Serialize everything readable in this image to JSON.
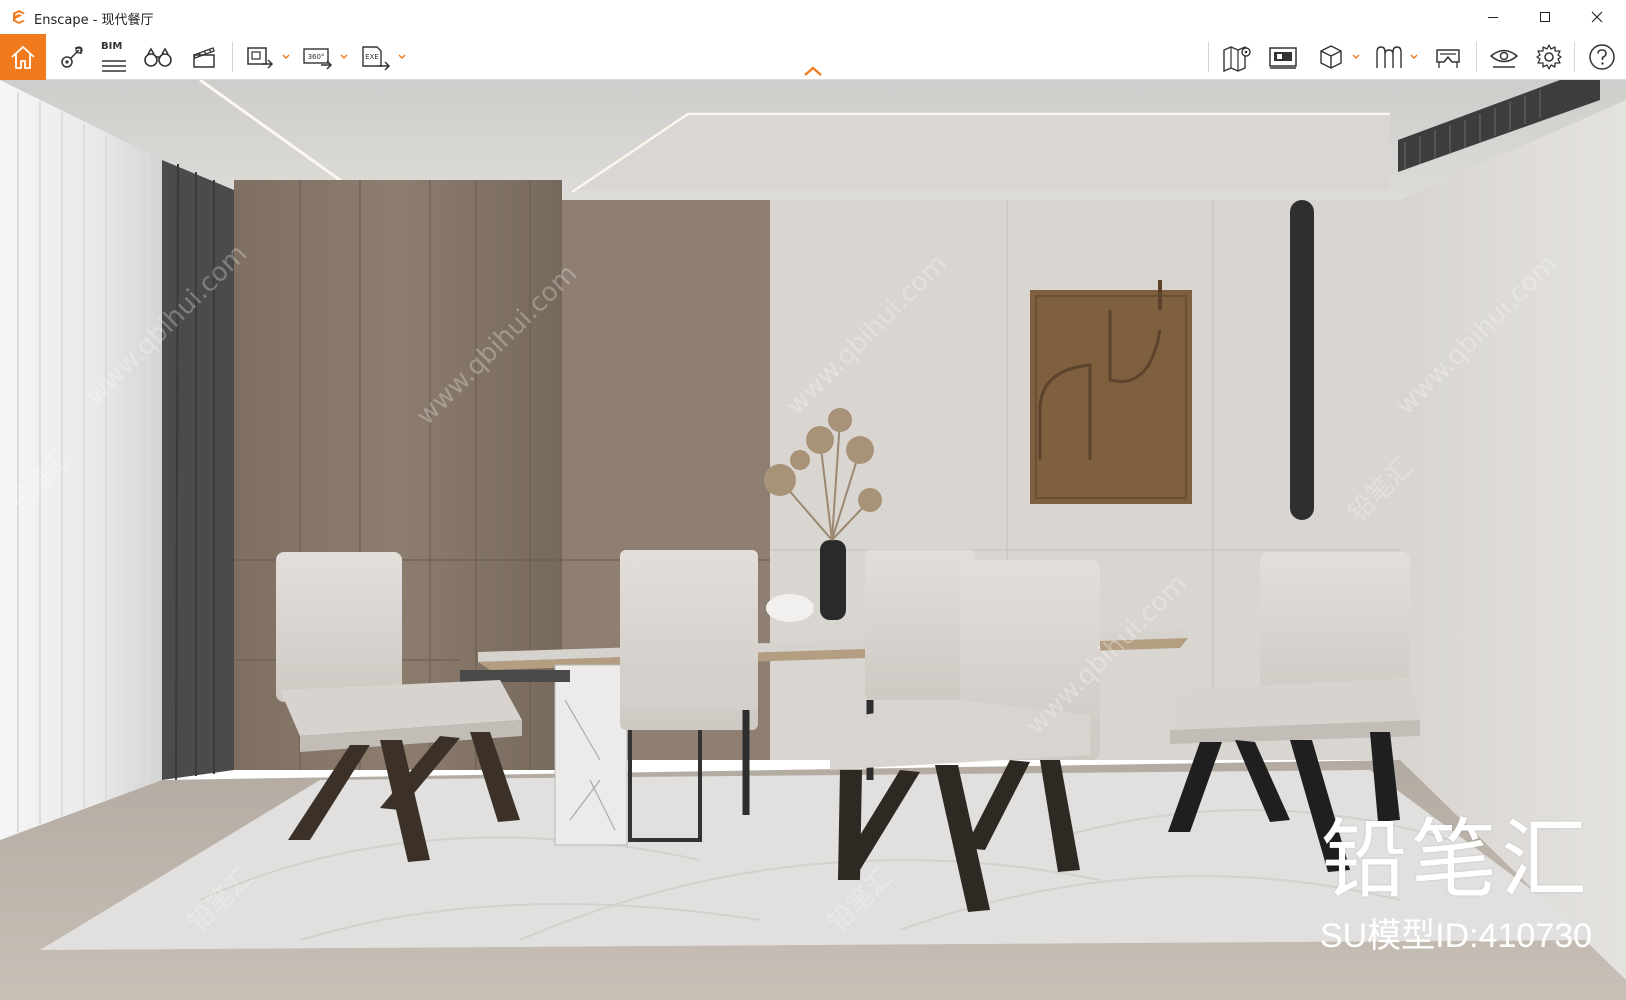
{
  "window": {
    "app_name": "Enscape",
    "title": "Enscape - 现代餐厅",
    "accent_color": "#f07a1c"
  },
  "toolbar": {
    "home": {
      "icon": "home-icon"
    },
    "left_tools": [
      {
        "name": "views-icon"
      },
      {
        "name": "bim-icon",
        "label": "BIM"
      },
      {
        "name": "binoculars-icon"
      },
      {
        "name": "clapperboard-icon"
      }
    ],
    "export_tools": [
      {
        "name": "screenshot-export-icon",
        "label": ""
      },
      {
        "name": "panorama-export-icon",
        "label": "360°"
      },
      {
        "name": "exe-export-icon",
        "label": "EXE"
      }
    ],
    "right_tools": [
      {
        "name": "map-icon"
      },
      {
        "name": "presentation-icon"
      },
      {
        "name": "cube-icon"
      },
      {
        "name": "asset-library-icon"
      },
      {
        "name": "vr-headset-icon"
      },
      {
        "name": "visibility-icon"
      },
      {
        "name": "settings-icon"
      },
      {
        "name": "help-icon"
      }
    ]
  },
  "watermark": {
    "brand": "铅笔汇",
    "model_id": "SU模型ID:410730",
    "repeated": [
      "铅笔汇",
      "www.qbihui.com"
    ]
  }
}
